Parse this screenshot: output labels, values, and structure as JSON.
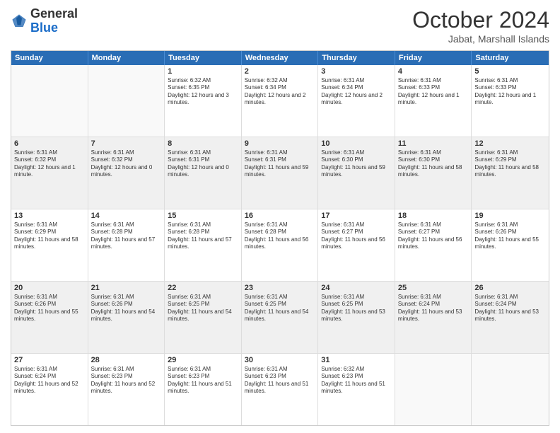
{
  "logo": {
    "general": "General",
    "blue": "Blue"
  },
  "header": {
    "month": "October 2024",
    "location": "Jabat, Marshall Islands"
  },
  "weekdays": [
    "Sunday",
    "Monday",
    "Tuesday",
    "Wednesday",
    "Thursday",
    "Friday",
    "Saturday"
  ],
  "weeks": [
    [
      {
        "day": "",
        "text": "",
        "empty": true
      },
      {
        "day": "",
        "text": "",
        "empty": true
      },
      {
        "day": "1",
        "text": "Sunrise: 6:32 AM\nSunset: 6:35 PM\nDaylight: 12 hours and 3 minutes."
      },
      {
        "day": "2",
        "text": "Sunrise: 6:32 AM\nSunset: 6:34 PM\nDaylight: 12 hours and 2 minutes."
      },
      {
        "day": "3",
        "text": "Sunrise: 6:31 AM\nSunset: 6:34 PM\nDaylight: 12 hours and 2 minutes."
      },
      {
        "day": "4",
        "text": "Sunrise: 6:31 AM\nSunset: 6:33 PM\nDaylight: 12 hours and 1 minute."
      },
      {
        "day": "5",
        "text": "Sunrise: 6:31 AM\nSunset: 6:33 PM\nDaylight: 12 hours and 1 minute."
      }
    ],
    [
      {
        "day": "6",
        "text": "Sunrise: 6:31 AM\nSunset: 6:32 PM\nDaylight: 12 hours and 1 minute."
      },
      {
        "day": "7",
        "text": "Sunrise: 6:31 AM\nSunset: 6:32 PM\nDaylight: 12 hours and 0 minutes."
      },
      {
        "day": "8",
        "text": "Sunrise: 6:31 AM\nSunset: 6:31 PM\nDaylight: 12 hours and 0 minutes."
      },
      {
        "day": "9",
        "text": "Sunrise: 6:31 AM\nSunset: 6:31 PM\nDaylight: 11 hours and 59 minutes."
      },
      {
        "day": "10",
        "text": "Sunrise: 6:31 AM\nSunset: 6:30 PM\nDaylight: 11 hours and 59 minutes."
      },
      {
        "day": "11",
        "text": "Sunrise: 6:31 AM\nSunset: 6:30 PM\nDaylight: 11 hours and 58 minutes."
      },
      {
        "day": "12",
        "text": "Sunrise: 6:31 AM\nSunset: 6:29 PM\nDaylight: 11 hours and 58 minutes."
      }
    ],
    [
      {
        "day": "13",
        "text": "Sunrise: 6:31 AM\nSunset: 6:29 PM\nDaylight: 11 hours and 58 minutes."
      },
      {
        "day": "14",
        "text": "Sunrise: 6:31 AM\nSunset: 6:28 PM\nDaylight: 11 hours and 57 minutes."
      },
      {
        "day": "15",
        "text": "Sunrise: 6:31 AM\nSunset: 6:28 PM\nDaylight: 11 hours and 57 minutes."
      },
      {
        "day": "16",
        "text": "Sunrise: 6:31 AM\nSunset: 6:28 PM\nDaylight: 11 hours and 56 minutes."
      },
      {
        "day": "17",
        "text": "Sunrise: 6:31 AM\nSunset: 6:27 PM\nDaylight: 11 hours and 56 minutes."
      },
      {
        "day": "18",
        "text": "Sunrise: 6:31 AM\nSunset: 6:27 PM\nDaylight: 11 hours and 56 minutes."
      },
      {
        "day": "19",
        "text": "Sunrise: 6:31 AM\nSunset: 6:26 PM\nDaylight: 11 hours and 55 minutes."
      }
    ],
    [
      {
        "day": "20",
        "text": "Sunrise: 6:31 AM\nSunset: 6:26 PM\nDaylight: 11 hours and 55 minutes."
      },
      {
        "day": "21",
        "text": "Sunrise: 6:31 AM\nSunset: 6:26 PM\nDaylight: 11 hours and 54 minutes."
      },
      {
        "day": "22",
        "text": "Sunrise: 6:31 AM\nSunset: 6:25 PM\nDaylight: 11 hours and 54 minutes."
      },
      {
        "day": "23",
        "text": "Sunrise: 6:31 AM\nSunset: 6:25 PM\nDaylight: 11 hours and 54 minutes."
      },
      {
        "day": "24",
        "text": "Sunrise: 6:31 AM\nSunset: 6:25 PM\nDaylight: 11 hours and 53 minutes."
      },
      {
        "day": "25",
        "text": "Sunrise: 6:31 AM\nSunset: 6:24 PM\nDaylight: 11 hours and 53 minutes."
      },
      {
        "day": "26",
        "text": "Sunrise: 6:31 AM\nSunset: 6:24 PM\nDaylight: 11 hours and 53 minutes."
      }
    ],
    [
      {
        "day": "27",
        "text": "Sunrise: 6:31 AM\nSunset: 6:24 PM\nDaylight: 11 hours and 52 minutes."
      },
      {
        "day": "28",
        "text": "Sunrise: 6:31 AM\nSunset: 6:23 PM\nDaylight: 11 hours and 52 minutes."
      },
      {
        "day": "29",
        "text": "Sunrise: 6:31 AM\nSunset: 6:23 PM\nDaylight: 11 hours and 51 minutes."
      },
      {
        "day": "30",
        "text": "Sunrise: 6:31 AM\nSunset: 6:23 PM\nDaylight: 11 hours and 51 minutes."
      },
      {
        "day": "31",
        "text": "Sunrise: 6:32 AM\nSunset: 6:23 PM\nDaylight: 11 hours and 51 minutes."
      },
      {
        "day": "",
        "text": "",
        "empty": true
      },
      {
        "day": "",
        "text": "",
        "empty": true
      }
    ]
  ]
}
